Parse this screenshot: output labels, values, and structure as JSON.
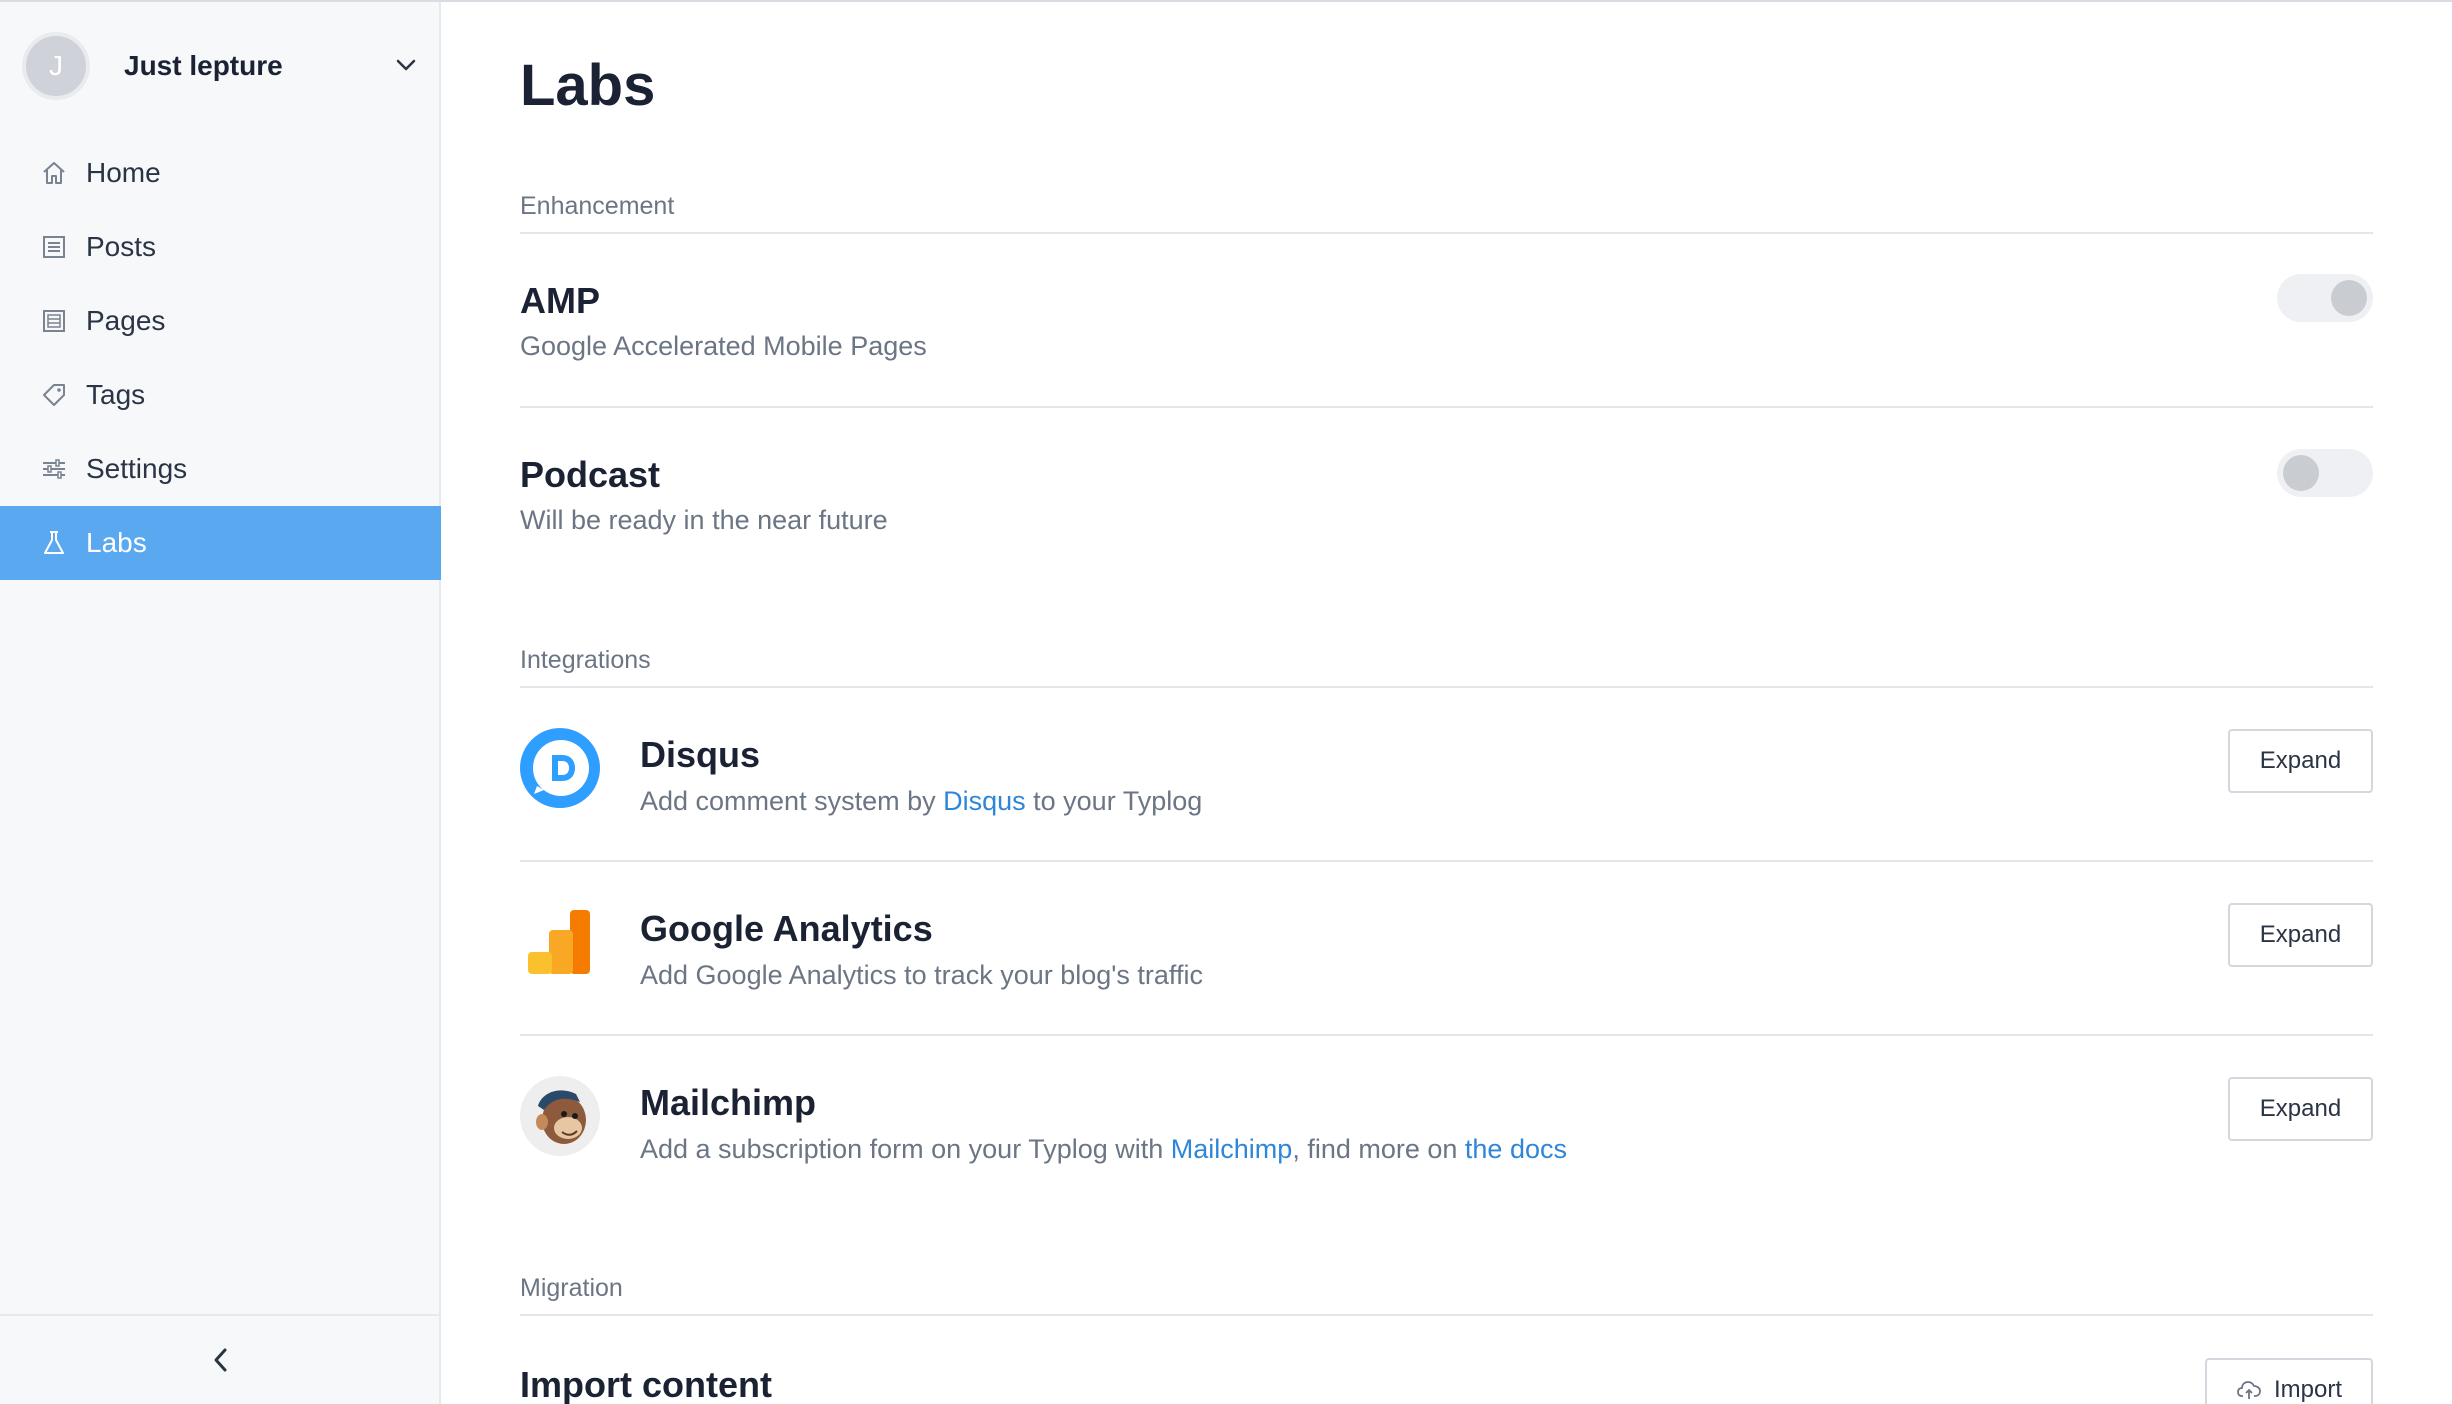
{
  "account": {
    "initial": "J",
    "name": "Just lepture"
  },
  "nav": {
    "items": [
      {
        "label": "Home"
      },
      {
        "label": "Posts"
      },
      {
        "label": "Pages"
      },
      {
        "label": "Tags"
      },
      {
        "label": "Settings"
      },
      {
        "label": "Labs",
        "active": true
      }
    ]
  },
  "page": {
    "title": "Labs"
  },
  "enhancement": {
    "label": "Enhancement",
    "items": [
      {
        "title": "AMP",
        "desc": "Google Accelerated Mobile Pages",
        "enabled": true
      },
      {
        "title": "Podcast",
        "desc": "Will be ready in the near future",
        "enabled": false
      }
    ]
  },
  "integrations": {
    "label": "Integrations",
    "expand_label": "Expand",
    "disqus": {
      "title": "Disqus",
      "desc_pre": "Add comment system by ",
      "link": "Disqus",
      "desc_post": " to your Typlog"
    },
    "ga": {
      "title": "Google Analytics",
      "desc": "Add Google Analytics to track your blog's traffic"
    },
    "mailchimp": {
      "title": "Mailchimp",
      "desc_pre": "Add a subscription form on your Typlog with ",
      "link1": "Mailchimp",
      "desc_mid": ", find more on ",
      "link2": "the docs"
    }
  },
  "migration": {
    "label": "Migration",
    "import_title": "Import content",
    "import_button": "Import"
  },
  "colors": {
    "accent": "#5aa8f0",
    "link": "#2f86d8",
    "disqus": "#2e9fff"
  },
  "icons": [
    "home-icon",
    "posts-icon",
    "pages-icon",
    "tag-icon",
    "settings-icon",
    "labs-flask-icon",
    "chevron-down-icon",
    "chevron-left-icon",
    "cloud-upload-icon"
  ]
}
